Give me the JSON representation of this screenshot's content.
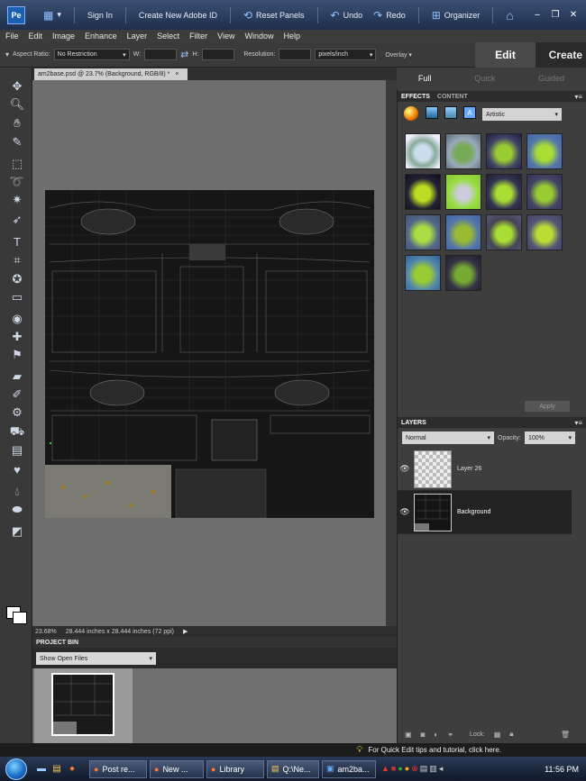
{
  "titlebar": {
    "logo": "Pe",
    "sign_in": "Sign In",
    "create_id": "Create New Adobe ID",
    "reset_panels": "Reset Panels",
    "undo": "Undo",
    "redo": "Redo",
    "organizer": "Organizer"
  },
  "menu": [
    "File",
    "Edit",
    "Image",
    "Enhance",
    "Layer",
    "Select",
    "Filter",
    "View",
    "Window",
    "Help"
  ],
  "options": {
    "aspect_label": "Aspect Ratio:",
    "aspect_value": "No Restriction",
    "w_label": "W:",
    "h_label": "H:",
    "res_label": "Resolution:",
    "res_unit": "pixels/inch",
    "overlay": "Overlay"
  },
  "modes": {
    "edit": "Edit",
    "create": "Create"
  },
  "subtabs": [
    "Full",
    "Quick",
    "Guided"
  ],
  "document": {
    "tab_title": "am2base.psd @ 23.7% (Background, RGB/8) *",
    "zoom": "23.68%",
    "dimensions": "28.444 inches x 28.444 inches (72 ppi)"
  },
  "project_bin": {
    "title": "PROJECT BIN",
    "dropdown": "Show Open Files"
  },
  "effects": {
    "tab_effects": "EFFECTS",
    "tab_content": "CONTENT",
    "category": "Artistic",
    "apply": "Apply"
  },
  "layers": {
    "title": "LAYERS",
    "blend_mode": "Normal",
    "opacity_label": "Opacity:",
    "opacity_value": "100%",
    "items": [
      {
        "name": "Layer 26"
      },
      {
        "name": "Background"
      }
    ],
    "lock_label": "Lock:"
  },
  "tips": "For Quick Edit tips and tutorial, click here.",
  "taskbar": {
    "buttons": [
      "Post re...",
      "New ...",
      "Library",
      "Q:\\Ne...",
      "am2ba..."
    ],
    "clock": "11:56 PM"
  }
}
